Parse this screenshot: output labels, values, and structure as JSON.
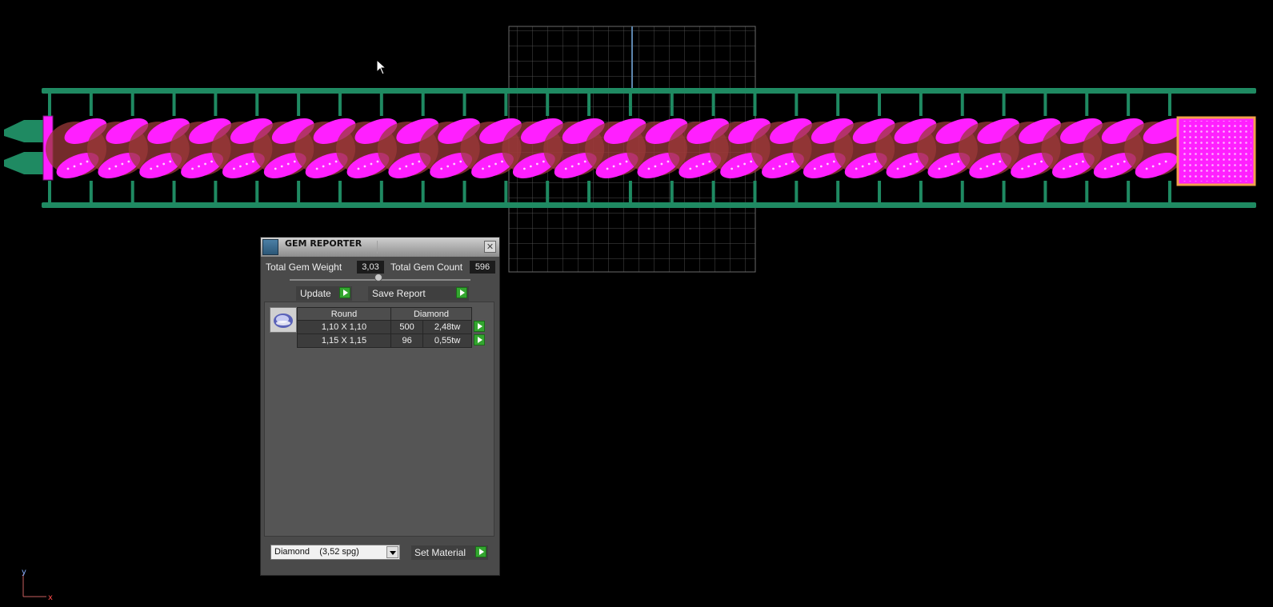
{
  "colors": {
    "background": "#000000",
    "frame": "#1f8a62",
    "gem": "#ff1fff",
    "setting": "#9b3a3a",
    "selection": "#f2a14a",
    "grid": "#5a5a5a",
    "panel": "#4a4a4a"
  },
  "viewport": {
    "chain_links": 27,
    "grid_cols": 16,
    "grid_rows": 16,
    "axis": {
      "y_label": "y",
      "x_label": "x"
    }
  },
  "panel": {
    "title": "GEM REPORTER",
    "total_weight_label": "Total Gem Weight",
    "total_weight_value": "3,03",
    "total_count_label": "Total Gem Count",
    "total_count_value": "596",
    "update_label": "Update",
    "save_report_label": "Save Report",
    "table": {
      "headers": [
        "Round",
        "Diamond"
      ],
      "rows": [
        {
          "size": "1,10 X 1,10",
          "count": "500",
          "weight": "2,48tw"
        },
        {
          "size": "1,15 X 1,15",
          "count": "96",
          "weight": "0,55tw"
        }
      ]
    },
    "material_select": "Diamond    (3,52 spg)",
    "set_material_label": "Set Material"
  }
}
